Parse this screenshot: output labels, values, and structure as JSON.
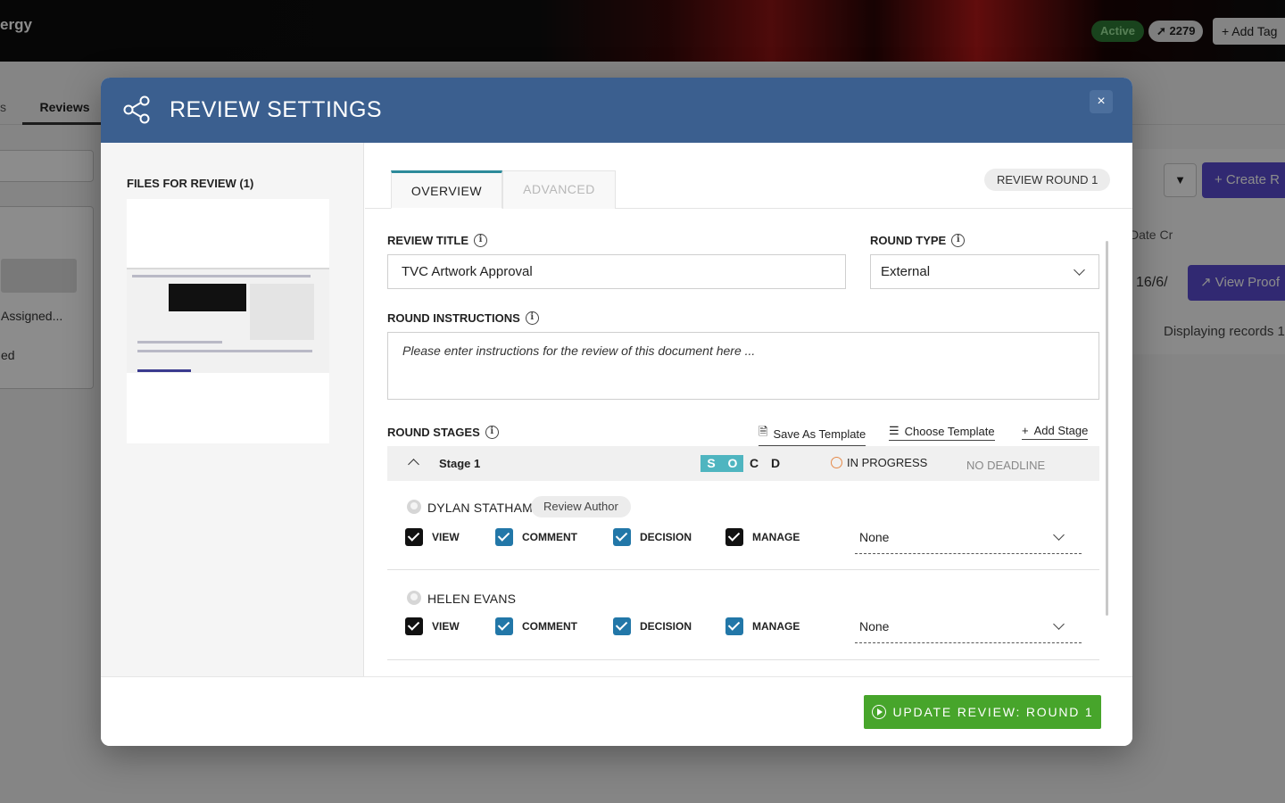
{
  "background": {
    "brand": "ergy",
    "status_pill": "Active",
    "count_pill": "2279",
    "add_tag": "+ Add Tag",
    "tabs": [
      "s",
      "Reviews"
    ],
    "left_items": [
      "Assigned...",
      "ed"
    ],
    "filter_icon": "filter-icon",
    "create_button": "+ Create R",
    "date_column": "Date Cr",
    "date_value": "16/6/",
    "view_proof": "View Proof",
    "records_text": "Displaying records 1"
  },
  "modal": {
    "title": "REVIEW SETTINGS",
    "close": "×",
    "files_label": "FILES FOR REVIEW (1)",
    "tabs": {
      "overview": "OVERVIEW",
      "advanced": "ADVANCED"
    },
    "round_badge": "REVIEW ROUND 1",
    "review_title": {
      "label": "REVIEW TITLE",
      "value": "TVC Artwork Approval"
    },
    "round_type": {
      "label": "ROUND TYPE",
      "value": "External"
    },
    "instructions": {
      "label": "ROUND INSTRUCTIONS",
      "placeholder": "Please enter instructions for the review of this document here ..."
    },
    "stages": {
      "label": "ROUND STAGES",
      "save_template": "Save As Template",
      "choose_template": "Choose Template",
      "add_stage": "Add Stage",
      "stage": {
        "name": "Stage 1",
        "flags": [
          "S",
          "O",
          "C",
          "D"
        ],
        "status": "IN PROGRESS",
        "deadline": "NO DEADLINE"
      },
      "members": [
        {
          "name": "DYLAN STATHAM",
          "badge": "Review Author",
          "permissions": {
            "view": "VIEW",
            "comment": "COMMENT",
            "decision": "DECISION",
            "manage": "MANAGE"
          },
          "select": "None"
        },
        {
          "name": "HELEN EVANS",
          "permissions": {
            "view": "VIEW",
            "comment": "COMMENT",
            "decision": "DECISION",
            "manage": "MANAGE"
          },
          "select": "None"
        }
      ]
    },
    "update_button": "UPDATE REVIEW: ROUND 1"
  },
  "colors": {
    "header": "#3b5f8f",
    "update_button": "#47a52b",
    "active_stage_flag": "#4fb5c0",
    "checkbox_blue": "#2277a8",
    "create_button": "#5a4ccf"
  }
}
